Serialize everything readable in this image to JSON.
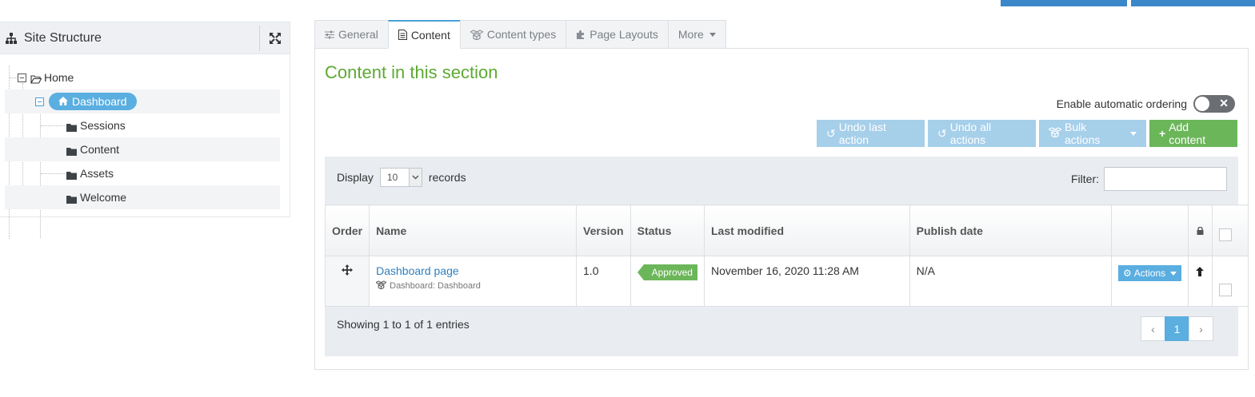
{
  "site_structure": {
    "title": "Site Structure",
    "tree": [
      {
        "label": "Home",
        "icon": "folder-open-icon"
      },
      {
        "label": "Dashboard",
        "icon": "home-icon"
      },
      {
        "label": "Sessions",
        "icon": "folder-icon"
      },
      {
        "label": "Content",
        "icon": "folder-icon"
      },
      {
        "label": "Assets",
        "icon": "folder-icon"
      },
      {
        "label": "Welcome",
        "icon": "folder-icon"
      }
    ]
  },
  "tabs": [
    {
      "label": "General",
      "icon": "sliders-icon"
    },
    {
      "label": "Content",
      "icon": "document-icon"
    },
    {
      "label": "Content types",
      "icon": "cubes-icon"
    },
    {
      "label": "Page Layouts",
      "icon": "puzzle-icon"
    },
    {
      "label": "More"
    }
  ],
  "section": {
    "title": "Content in this section",
    "auto_ordering_label": "Enable automatic ordering",
    "buttons": {
      "undo_last": "Undo last action",
      "undo_all": "Undo all actions",
      "bulk": "Bulk actions",
      "add": "Add content"
    }
  },
  "listing": {
    "display_label": "Display",
    "page_size": "10",
    "records_label": "records",
    "filter_label": "Filter:",
    "columns": [
      "Order",
      "Name",
      "Version",
      "Status",
      "Last modified",
      "Publish date"
    ],
    "rows": [
      {
        "name": "Dashboard page",
        "type": "Dashboard: Dashboard",
        "version": "1.0",
        "status": "Approved",
        "last_modified": "November 16, 2020 11:28 AM",
        "publish_date": "N/A",
        "actions_label": "Actions"
      }
    ],
    "showing": "Showing 1 to 1 of 1 entries",
    "pagination": {
      "prev": "‹",
      "current": "1",
      "next": "›"
    }
  },
  "colors": {
    "accent": "#5aaee0",
    "title_green": "#5da933",
    "approved_green": "#6cb65a",
    "light_button": "#a6cfea"
  }
}
